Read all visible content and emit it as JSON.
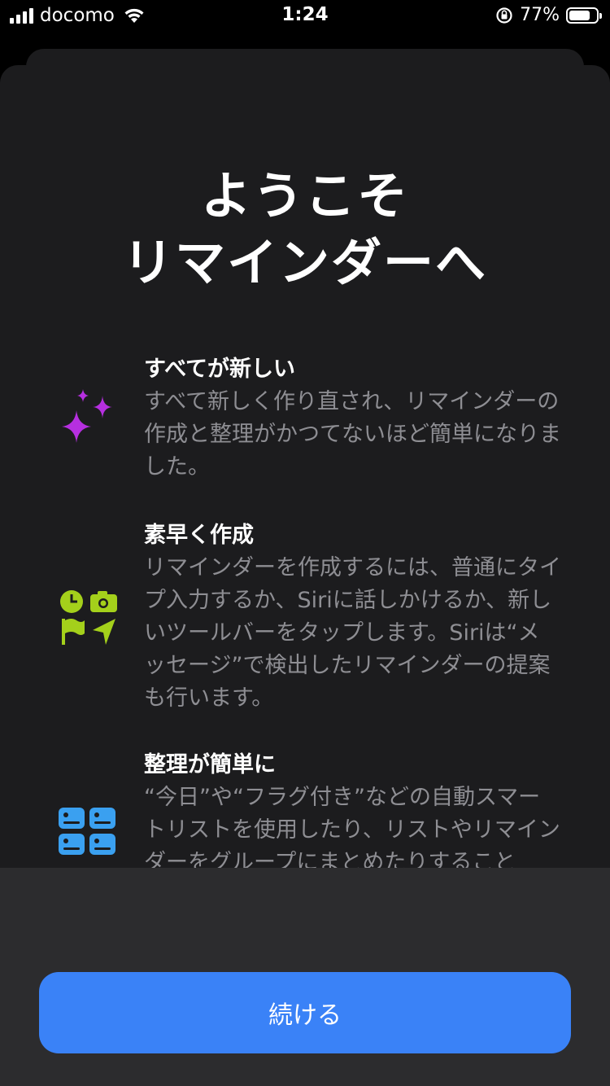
{
  "status_bar": {
    "carrier": "docomo",
    "time": "1:24",
    "battery": "77%",
    "battery_level": 0.77
  },
  "title": {
    "line1": "ようこそ",
    "line2": "リマインダーへ"
  },
  "features": [
    {
      "icon": "sparkles-icon",
      "heading": "すべてが新しい",
      "body": "すべて新しく作り直され、リマインダーの作成と整理がかつてないほど簡単になりました。"
    },
    {
      "icon": "toolbar-icons",
      "heading": "素早く作成",
      "body": "リマインダーを作成するには、普通にタイプ入力するか、Siriに話しかけるか、新しいツールバーをタップします。Siriは“メッセージ”で検出したリマインダーの提案も行います。"
    },
    {
      "icon": "lists-grid-icon",
      "heading": "整理が簡単に",
      "body": "“今日”や“フラグ付き”などの自動スマートリストを使用したり、リストやリマインダーをグループにまとめたりすること"
    }
  ],
  "continue_label": "続ける",
  "colors": {
    "accent": "#3a82f7",
    "sparkles": "#b62fe0",
    "toolbar": "#a4d01b",
    "lists": "#3aa0f0"
  }
}
